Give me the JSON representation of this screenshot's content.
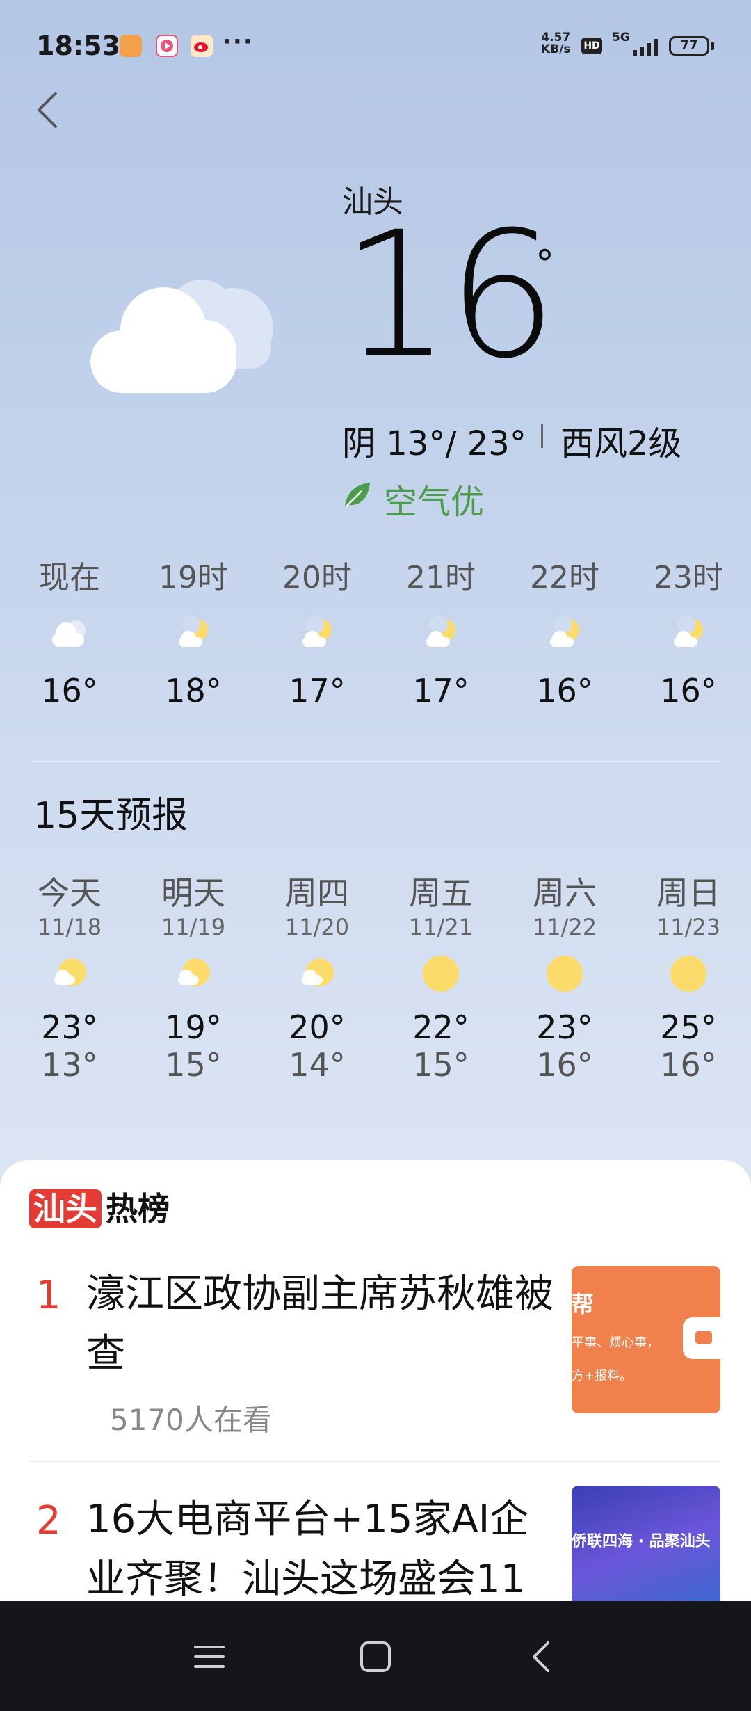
{
  "status_bar": {
    "time": "18:53",
    "net_speed_value": "4.57",
    "net_speed_unit": "KB/s",
    "hd": "HD",
    "signal": "5G",
    "battery": "77",
    "more": "···"
  },
  "weather": {
    "city": "汕头",
    "temp": "16",
    "degree": "°",
    "condition_range": "阴 13°/ 23°",
    "wind": "西风2级",
    "aqi": "空气优",
    "condition_icon": "cloudy-icon"
  },
  "hourly": [
    {
      "label": "现在",
      "temp": "16°",
      "icon": "cloud-icon"
    },
    {
      "label": "19时",
      "temp": "18°",
      "icon": "moon-cloud-icon"
    },
    {
      "label": "20时",
      "temp": "17°",
      "icon": "moon-cloud-icon"
    },
    {
      "label": "21时",
      "temp": "17°",
      "icon": "moon-cloud-icon"
    },
    {
      "label": "22时",
      "temp": "16°",
      "icon": "moon-cloud-icon"
    },
    {
      "label": "23时",
      "temp": "16°",
      "icon": "moon-cloud-icon"
    }
  ],
  "forecast": {
    "title": "15天预报",
    "days": [
      {
        "name": "今天",
        "date": "11/18",
        "high": "23°",
        "low": "13°",
        "icon": "sun-cloud-icon"
      },
      {
        "name": "明天",
        "date": "11/19",
        "high": "19°",
        "low": "15°",
        "icon": "sun-cloud-icon"
      },
      {
        "name": "周四",
        "date": "11/20",
        "high": "20°",
        "low": "14°",
        "icon": "sun-cloud-icon"
      },
      {
        "name": "周五",
        "date": "11/21",
        "high": "22°",
        "low": "15°",
        "icon": "sun-icon"
      },
      {
        "name": "周六",
        "date": "11/22",
        "high": "23°",
        "low": "16°",
        "icon": "sun-icon"
      },
      {
        "name": "周日",
        "date": "11/23",
        "high": "25°",
        "low": "16°",
        "icon": "sun-icon"
      }
    ]
  },
  "hot_list": {
    "brand": "汕头",
    "title_suffix": "热榜",
    "items": [
      {
        "rank": "1",
        "title": "濠江区政协副主席苏秋雄被查",
        "viewers": "5170人在看",
        "thumb_text_1": "帮",
        "thumb_text_2": "平事、烦心事，",
        "thumb_text_3": "方+报料。"
      },
      {
        "rank": "2",
        "title": "16大电商平台+15家AI企业齐聚！汕头这场盛会11",
        "viewers": "",
        "thumb_text_1": "侨联四海 · 品聚汕头"
      }
    ]
  },
  "colors": {
    "accent_red": "#e43b35",
    "aqi_green": "#4b9c4b",
    "sun_yellow": "#fbdc6a"
  }
}
